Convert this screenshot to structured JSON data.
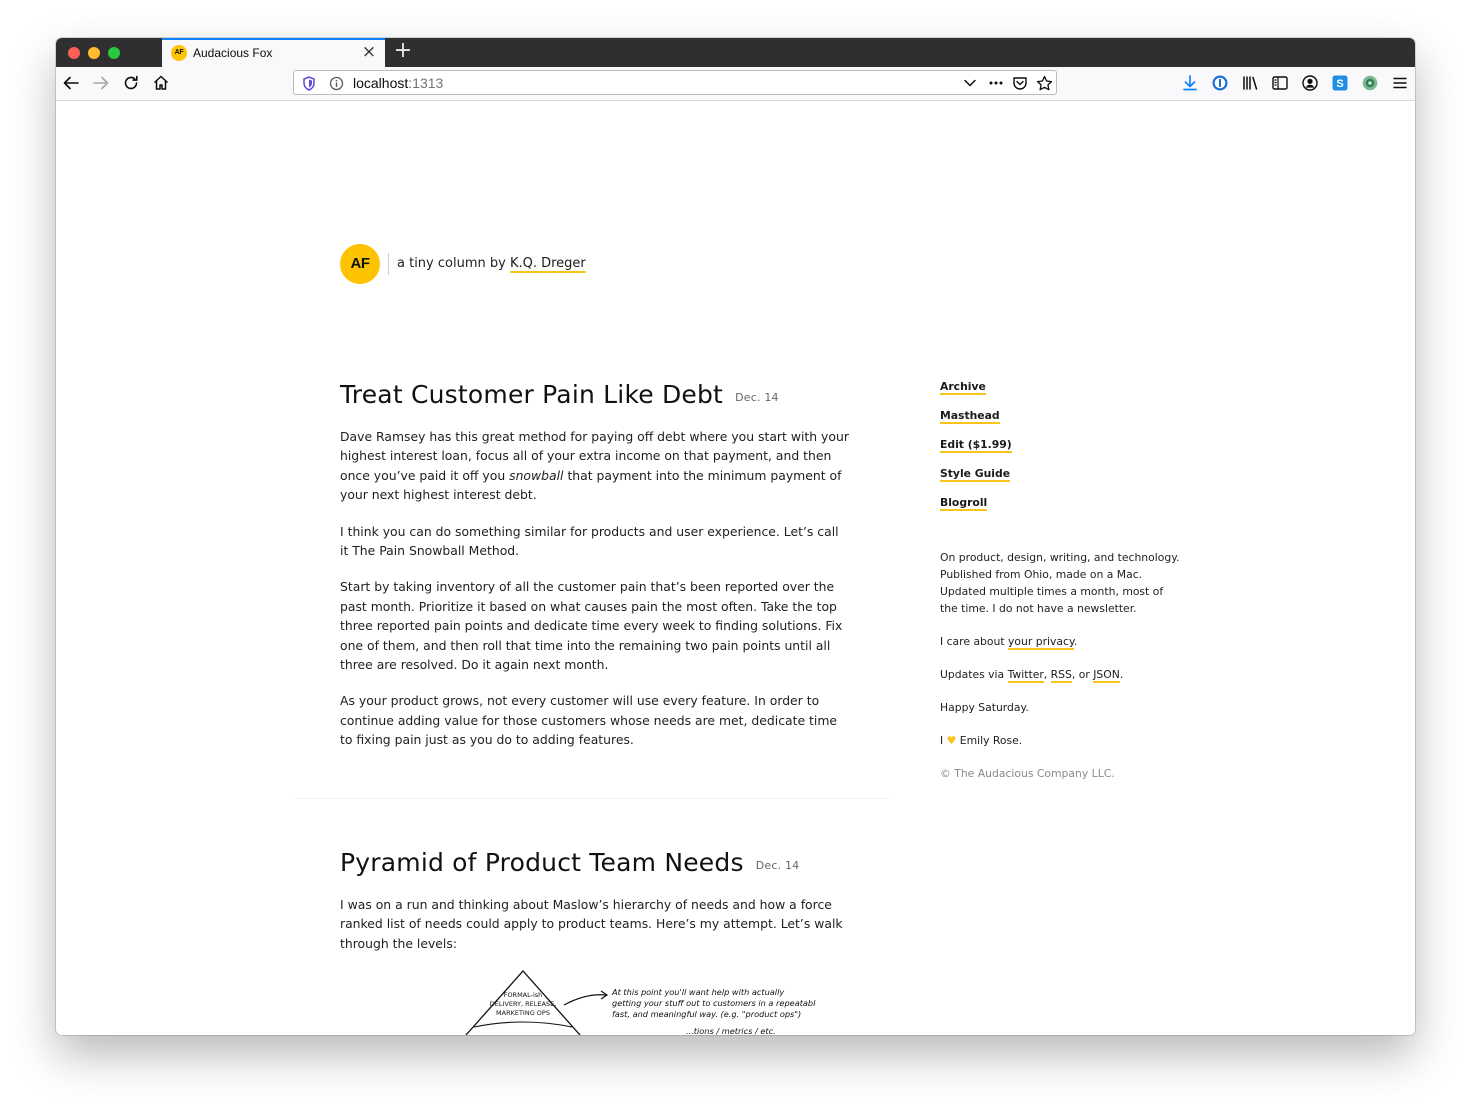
{
  "browser": {
    "tab_title": "Audacious Fox",
    "tab_favicon_text": "AF",
    "url_host": "localhost",
    "url_port": ":1313",
    "new_tab_label": "+",
    "close_tab_label": "×"
  },
  "site": {
    "logo_text": "AF",
    "tagline_prefix": "a tiny column by ",
    "author": "K.Q. Dreger",
    "accent_color": "#fdc300"
  },
  "posts": [
    {
      "title": "Treat Customer Pain Like Debt",
      "date": "Dec. 14",
      "p1_a": "Dave Ramsey has this great method for paying off debt where you start with your highest interest loan, focus all of your extra income on that payment, and then once you’ve paid it off you ",
      "p1_em": "snowball",
      "p1_b": " that payment into the minimum payment of your next highest interest debt.",
      "p2": "I think you can do something similar for products and user experience. Let’s call it The Pain Snowball Method.",
      "p3": "Start by taking inventory of all the customer pain that’s been reported over the past month. Prioritize it based on what causes pain the most often. Take the top three reported pain points and dedicate time every week to finding solutions. Fix one of them, and then roll that time into the remaining two pain points until all three are resolved. Do it again next month.",
      "p4": "As your product grows, not every customer will use every feature. In order to continue adding value for those customers whose needs are met, dedicate time to fixing pain just as you do to adding features."
    },
    {
      "title": "Pyramid of Product Team Needs",
      "date": "Dec. 14",
      "p1": "I was on a run and thinking about Maslow’s hierarchy of needs and how a force ranked list of needs could apply to product teams. Here’s my attempt. Let’s walk through the levels:",
      "sketch_top_label": "FORMAL-ish DELIVERY, RELEASE, MARKETING OPS",
      "sketch_note_1": "At this point you'll want help with actually",
      "sketch_note_2": "getting your stuff out to customers in a repeatable,",
      "sketch_note_3": "fast, and meaningful way. (e.g. \"product ops\")",
      "sketch_note_4": "...tions / metrics / etc."
    }
  ],
  "sidebar": {
    "nav": [
      "Archive",
      "Masthead",
      "Edit ($1.99)",
      "Style Guide",
      "Blogroll"
    ],
    "about": "On product, design, writing, and technology. Published from Ohio, made on a Mac. Updated multiple times a month, most of the time. I do not have a newsletter.",
    "privacy_prefix": "I care about ",
    "privacy_link": "your privacy",
    "privacy_suffix": ".",
    "updates_prefix": "Updates via ",
    "updates_twitter": "Twitter",
    "updates_sep1": ", ",
    "updates_rss": "RSS",
    "updates_sep2": ", or ",
    "updates_json": "JSON",
    "updates_suffix": ".",
    "greeting": "Happy Saturday.",
    "love_prefix": "I ",
    "love_heart": "♥",
    "love_name": " Emily Rose.",
    "copyright": "© The Audacious Company LLC."
  }
}
